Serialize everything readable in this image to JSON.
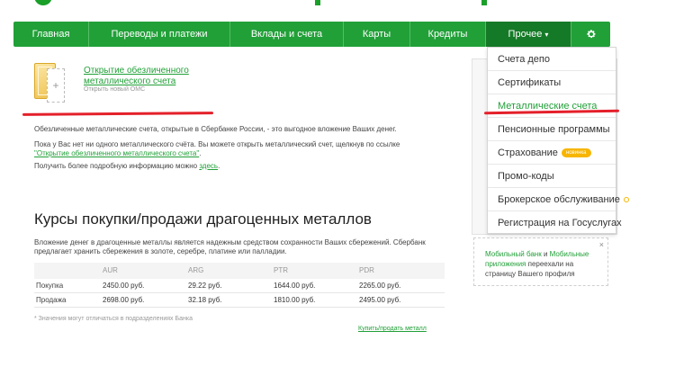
{
  "nav": {
    "items": [
      {
        "label": "Главная"
      },
      {
        "label": "Переводы и платежи"
      },
      {
        "label": "Вклады и счета"
      },
      {
        "label": "Карты"
      },
      {
        "label": "Кредиты"
      },
      {
        "label": "Прочее"
      }
    ],
    "active_chevron": "▾",
    "gear_icon": "gear-icon"
  },
  "dropdown": {
    "items": [
      {
        "label": "Счета депо"
      },
      {
        "label": "Сертификаты"
      },
      {
        "label": "Металлические счета"
      },
      {
        "label": "Пенсионные программы"
      },
      {
        "label": "Страхование",
        "badge": "новинка"
      },
      {
        "label": "Промо-коды"
      },
      {
        "label": "Брокерское обслуживание"
      },
      {
        "label": "Регистрация на Госуслугах"
      }
    ]
  },
  "account": {
    "link": "Открытие обезличенного металлического счета",
    "sub": "Открыть новый ОМС"
  },
  "text": {
    "p1": "Обезличенные металлические счета, открытые в Сбербанке России, - это выгодное вложение Ваших денег.",
    "p2a": "Пока у Вас нет ни одного металлического счёта. Вы можете открыть металлический счет, щелкнув по ссылке",
    "p2_link": "\"Открытие обезличенного металлического счета\"",
    "p2b": ".",
    "p3a": "Получить более подробную информацию можно ",
    "p3_link": "здесь",
    "p3b": "."
  },
  "rates": {
    "title": "Курсы покупки/продажи драгоценных металлов",
    "desc": "Вложение денег в драгоценные металлы является надежным средством сохранности Ваших сбережений. Сбербанк предлагает хранить сбережения в золоте, серебре, платине или палладии.",
    "headers": [
      "",
      "AUR",
      "ARG",
      "PTR",
      "PDR"
    ],
    "rows": [
      {
        "label": "Покупка",
        "values": [
          "2450.00 руб.",
          "29.22 руб.",
          "1644.00 руб.",
          "2265.00 руб."
        ]
      },
      {
        "label": "Продажа",
        "values": [
          "2698.00 руб.",
          "32.18 руб.",
          "1810.00 руб.",
          "2495.00 руб."
        ]
      }
    ],
    "note": "* Значения могут отличаться в подразделениях Банка",
    "buy_link": "Купить/продать металл"
  },
  "info": {
    "link1": "Мобильный банк",
    "and": " и ",
    "link2": "Мобильные приложения",
    "rest": " переехали на страницу Вашего профиля",
    "close": "×"
  },
  "colors": {
    "accent": "#21a038",
    "active_nav": "#157a27",
    "highlight": "#e4202a",
    "badge": "#f7b500"
  }
}
